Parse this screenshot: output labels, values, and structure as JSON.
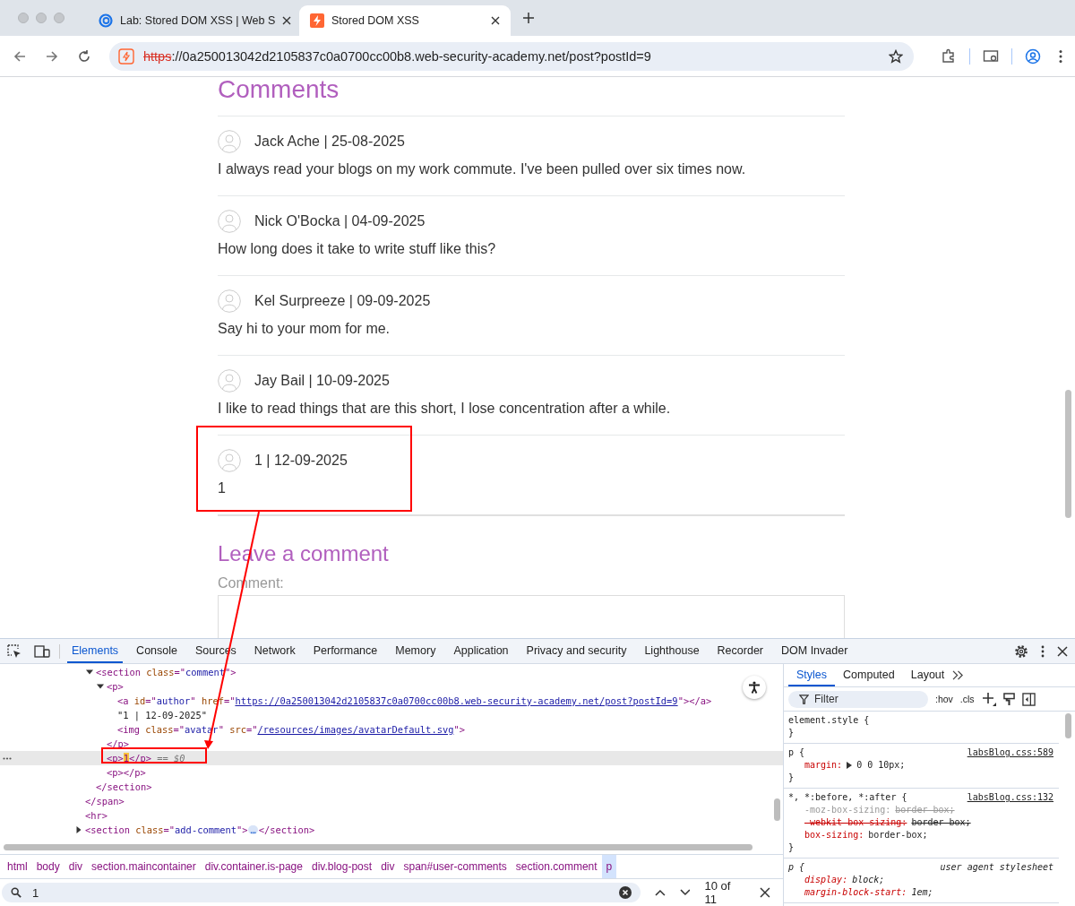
{
  "browser": {
    "tabs": [
      {
        "title": "Lab: Stored DOM XSS | Web S",
        "selected": false,
        "kind": "academy"
      },
      {
        "title": "Stored DOM XSS",
        "selected": true,
        "kind": "lab"
      }
    ],
    "address": {
      "scheme": "https",
      "insecure": true,
      "rest": "://0a250013042d2105837c0a0700cc00b8.web-security-academy.net/post?postId=9"
    }
  },
  "page": {
    "comments_heading": "Comments",
    "comments": [
      {
        "author": "Jack Ache | 25-08-2025",
        "text": "I always read your blogs on my work commute. I've been pulled over six times now."
      },
      {
        "author": "Nick O'Bocka | 04-09-2025",
        "text": "How long does it take to write stuff like this?"
      },
      {
        "author": "Kel Surpreeze | 09-09-2025",
        "text": "Say hi to your mom for me."
      },
      {
        "author": "Jay Bail | 10-09-2025",
        "text": "I like to read things that are this short, I lose concentration after a while."
      },
      {
        "author": "1 | 12-09-2025",
        "text": "1"
      }
    ],
    "form_heading": "Leave a comment",
    "comment_label": "Comment:"
  },
  "devtools": {
    "tabs": [
      {
        "label": "Elements",
        "selected": true
      },
      {
        "label": "Console",
        "selected": false
      },
      {
        "label": "Sources",
        "selected": false
      },
      {
        "label": "Network",
        "selected": false
      },
      {
        "label": "Performance",
        "selected": false
      },
      {
        "label": "Memory",
        "selected": false
      },
      {
        "label": "Application",
        "selected": false
      },
      {
        "label": "Privacy and security",
        "selected": false
      },
      {
        "label": "Lighthouse",
        "selected": false
      },
      {
        "label": "Recorder",
        "selected": false
      },
      {
        "label": "DOM Invader",
        "selected": false
      }
    ],
    "dom_tree": [
      {
        "expanded": true,
        "close": [
          {
            "kind": "tag",
            "text": "</span>"
          }
        ],
        "children": [
          {
            "expanded": true,
            "selected": false,
            "open": [
              {
                "kind": "tag",
                "text": "<section"
              },
              {
                "kind": "attr",
                "text": " class"
              },
              {
                "kind": "tag",
                "text": "=\""
              },
              {
                "kind": "value",
                "text": "comment"
              },
              {
                "kind": "tag",
                "text": "\">"
              }
            ],
            "close": [
              {
                "kind": "tag",
                "text": "</section>"
              }
            ],
            "children": [
              {
                "expanded": true,
                "selected": false,
                "open": [
                  {
                    "kind": "tag",
                    "text": "<p>"
                  }
                ],
                "close": [
                  {
                    "kind": "tag",
                    "text": "</p>"
                  }
                ],
                "children": [
                  {
                    "selected": false,
                    "open": [
                      {
                        "kind": "tag",
                        "text": "<a"
                      },
                      {
                        "kind": "attr",
                        "text": " id"
                      },
                      {
                        "kind": "tag",
                        "text": "=\""
                      },
                      {
                        "kind": "value",
                        "text": "author"
                      },
                      {
                        "kind": "tag",
                        "text": "\""
                      },
                      {
                        "kind": "attr",
                        "text": " href"
                      },
                      {
                        "kind": "tag",
                        "text": "=\""
                      },
                      {
                        "kind": "link",
                        "text": "https://0a250013042d2105837c0a0700cc00b8.web-security-academy.net/post?postId=9"
                      },
                      {
                        "kind": "tag",
                        "text": "\"></a>"
                      }
                    ]
                  },
                  {
                    "selected": false,
                    "open": [
                      {
                        "kind": "text",
                        "text": "\"1 | 12-09-2025\""
                      }
                    ]
                  },
                  {
                    "selected": false,
                    "open": [
                      {
                        "kind": "tag",
                        "text": "<img"
                      },
                      {
                        "kind": "attr",
                        "text": " class"
                      },
                      {
                        "kind": "tag",
                        "text": "=\""
                      },
                      {
                        "kind": "value",
                        "text": "avatar"
                      },
                      {
                        "kind": "tag",
                        "text": "\""
                      },
                      {
                        "kind": "attr",
                        "text": " src"
                      },
                      {
                        "kind": "tag",
                        "text": "=\""
                      },
                      {
                        "kind": "link",
                        "text": "/resources/images/avatarDefault.svg"
                      },
                      {
                        "kind": "tag",
                        "text": "\">"
                      }
                    ]
                  }
                ]
              },
              {
                "selected": true,
                "open": [
                  {
                    "kind": "tag",
                    "text": "<p>"
                  },
                  {
                    "kind": "match",
                    "text": "1"
                  },
                  {
                    "kind": "tag",
                    "text": "</p>"
                  },
                  {
                    "kind": "dim",
                    "text": " == $0"
                  }
                ]
              },
              {
                "selected": false,
                "open": [
                  {
                    "kind": "tag",
                    "text": "<p></p>"
                  }
                ]
              }
            ]
          }
        ]
      },
      {
        "selected": false,
        "open": [
          {
            "kind": "tag",
            "text": "<hr>"
          }
        ]
      },
      {
        "expanded": false,
        "selected": false,
        "open": [
          {
            "kind": "tag",
            "text": "<section"
          },
          {
            "kind": "attr",
            "text": " class"
          },
          {
            "kind": "tag",
            "text": "=\""
          },
          {
            "kind": "value",
            "text": "add-comment"
          },
          {
            "kind": "tag",
            "text": "\">"
          },
          {
            "kind": "ellipsis",
            "text": "…"
          },
          {
            "kind": "tag",
            "text": "</section>"
          }
        ]
      }
    ],
    "breadcrumbs": [
      {
        "label": "html",
        "selected": false
      },
      {
        "label": "body",
        "selected": false
      },
      {
        "label": "div",
        "selected": false
      },
      {
        "label": "section.maincontainer",
        "selected": false
      },
      {
        "label": "div.container.is-page",
        "selected": false
      },
      {
        "label": "div.blog-post",
        "selected": false
      },
      {
        "label": "div",
        "selected": false
      },
      {
        "label": "span#user-comments",
        "selected": false
      },
      {
        "label": "section.comment",
        "selected": false
      },
      {
        "label": "p",
        "selected": true
      }
    ],
    "search": {
      "value": "1",
      "count": "10 of 11"
    },
    "styles": {
      "tabs": [
        {
          "label": "Styles",
          "selected": true
        },
        {
          "label": "Computed",
          "selected": false
        },
        {
          "label": "Layout",
          "selected": false
        }
      ],
      "filter_placeholder": "Filter",
      "hov": ":hov",
      "cls": ".cls",
      "rules": [
        {
          "kind": "author",
          "selector": "element.style {",
          "close": "}"
        },
        {
          "kind": "author",
          "selector": "p {",
          "source": "labsBlog.css:589",
          "close": "}",
          "declarations": [
            {
              "property": "margin:",
              "value": "0 0 10px;",
              "invalid": false,
              "overridden": false,
              "expandable": true
            }
          ]
        },
        {
          "kind": "author",
          "selector": "*, *:before, *:after {",
          "source": "labsBlog.css:132",
          "close": "}",
          "declarations": [
            {
              "property": "-moz-box-sizing:",
              "value": "border-box;",
              "invalid": true,
              "overridden": false,
              "expandable": false
            },
            {
              "property": "-webkit-box-sizing:",
              "value": "border-box;",
              "invalid": false,
              "overridden": true,
              "expandable": false
            },
            {
              "property": "box-sizing:",
              "value": "border-box;",
              "invalid": false,
              "overridden": false,
              "expandable": false
            }
          ]
        },
        {
          "kind": "user-agent",
          "selector": "p {",
          "source": "user agent stylesheet",
          "declarations": [
            {
              "property": "display:",
              "value": "block;",
              "invalid": false,
              "overridden": false,
              "expandable": false
            },
            {
              "property": "margin-block-start:",
              "value": "1em;",
              "invalid": false,
              "overridden": false,
              "expandable": false
            }
          ]
        }
      ]
    }
  }
}
